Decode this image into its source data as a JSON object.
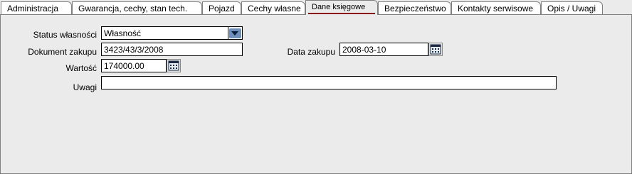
{
  "tabs": [
    {
      "label": "Administracja"
    },
    {
      "label": "Gwarancja, cechy, stan tech."
    },
    {
      "label": "Pojazd"
    },
    {
      "label": "Cechy własne"
    },
    {
      "label": "Dane księgowe",
      "active": true
    },
    {
      "label": "Bezpieczeństwo"
    },
    {
      "label": "Kontakty serwisowe"
    },
    {
      "label": "Opis / Uwagi"
    }
  ],
  "form": {
    "status_wlasnosci": {
      "label": "Status własności",
      "value": "Własność"
    },
    "dokument_zakupu": {
      "label": "Dokument zakupu",
      "value": "3423/43/3/2008"
    },
    "data_zakupu": {
      "label": "Data zakupu",
      "value": "2008-03-10"
    },
    "wartosc": {
      "label": "Wartość",
      "value": "174000.00"
    },
    "uwagi": {
      "label": "Uwagi",
      "value": ""
    }
  },
  "icons": {
    "dropdown": "chevron-down-icon",
    "calendar": "calendar-icon"
  },
  "colors": {
    "active_tab_underline": "#8b1a1a",
    "dropdown_button": "#6f8fb8",
    "panel_background": "#ebebeb"
  }
}
